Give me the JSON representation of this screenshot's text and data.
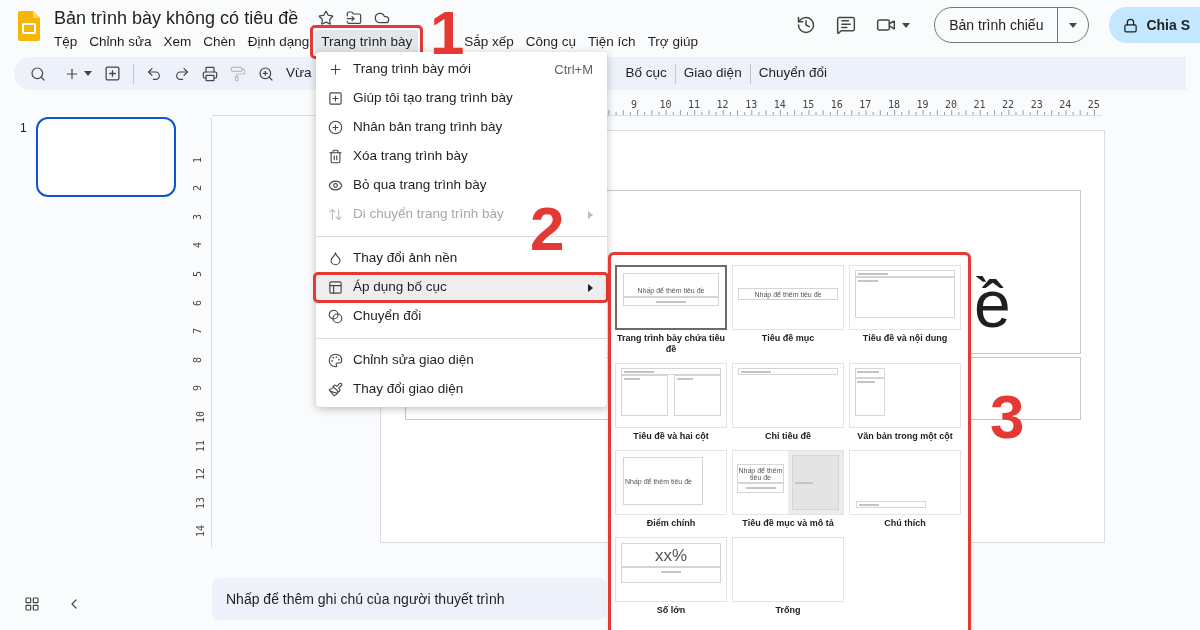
{
  "app": {
    "title": "Bản trình bày không có tiêu đề"
  },
  "menubar": [
    {
      "label": "Tệp",
      "selected": false,
      "annotated": false
    },
    {
      "label": "Chỉnh sửa",
      "selected": false,
      "annotated": false
    },
    {
      "label": "Xem",
      "selected": false,
      "annotated": false
    },
    {
      "label": "Chèn",
      "selected": false,
      "annotated": false
    },
    {
      "label": "Định dạng",
      "selected": false,
      "annotated": false
    },
    {
      "label": "Trang trình bày",
      "selected": true,
      "annotated": true
    },
    {
      "label": "Sắp xếp",
      "selected": false,
      "annotated": false
    },
    {
      "label": "Công cụ",
      "selected": false,
      "annotated": false
    },
    {
      "label": "Tiện ích",
      "selected": false,
      "annotated": false
    },
    {
      "label": "Trợ giúp",
      "selected": false,
      "annotated": false
    }
  ],
  "header_actions": {
    "present_button": "Bản trình chiếu",
    "share_button": "Chia S"
  },
  "toolbar": {
    "zoom_label": "Vừa",
    "paint_format": {
      "disabled": true
    },
    "buttons": [
      "Bố cục",
      "Giao diện",
      "Chuyển đổi"
    ]
  },
  "ruler": {
    "horizontal": [
      "9",
      "10",
      "11",
      "12",
      "13",
      "14",
      "15",
      "16",
      "17",
      "18",
      "19",
      "20",
      "21",
      "22",
      "23",
      "24",
      "25"
    ],
    "vertical": [
      "1",
      "2",
      "3",
      "4",
      "5",
      "6",
      "7",
      "8",
      "9",
      "10",
      "11",
      "12",
      "13",
      "14"
    ]
  },
  "filmstrip": {
    "slides": [
      {
        "number": "1",
        "selected": true
      }
    ]
  },
  "slide": {
    "title_visible": "ề"
  },
  "notes": {
    "placeholder": "Nhấp để thêm ghi chú của người thuyết trình"
  },
  "slide_menu": {
    "sections": [
      [
        {
          "label": "Trang trình bày mới",
          "shortcut": "Ctrl+M",
          "disabled": false,
          "submenu": false,
          "highlighted": false,
          "annotated": false
        },
        {
          "label": "Giúp tôi tạo trang trình bày",
          "disabled": false,
          "submenu": false,
          "highlighted": false,
          "annotated": false
        },
        {
          "label": "Nhân bản trang trình bày",
          "disabled": false,
          "submenu": false,
          "highlighted": false,
          "annotated": false
        },
        {
          "label": "Xóa trang trình bày",
          "disabled": false,
          "submenu": false,
          "highlighted": false,
          "annotated": false
        },
        {
          "label": "Bỏ qua trang trình bày",
          "disabled": false,
          "submenu": false,
          "highlighted": false,
          "annotated": false
        },
        {
          "label": "Di chuyển trang trình bày",
          "disabled": true,
          "submenu": true,
          "highlighted": false,
          "annotated": false
        }
      ],
      [
        {
          "label": "Thay đổi ảnh nền",
          "disabled": false,
          "submenu": false,
          "highlighted": false,
          "annotated": false
        },
        {
          "label": "Áp dụng bố cục",
          "disabled": false,
          "submenu": true,
          "highlighted": true,
          "annotated": true
        },
        {
          "label": "Chuyển đổi",
          "disabled": false,
          "submenu": false,
          "highlighted": false,
          "annotated": false
        }
      ],
      [
        {
          "label": "Chỉnh sửa giao diện",
          "disabled": false,
          "submenu": false,
          "highlighted": false,
          "annotated": false
        },
        {
          "label": "Thay đổi giao diện",
          "disabled": false,
          "submenu": false,
          "highlighted": false,
          "annotated": false
        }
      ]
    ]
  },
  "layout_submenu": {
    "annotated": true,
    "layouts": [
      {
        "kind": "title",
        "label": "Trang trình bày chứa tiêu đề",
        "selected": true,
        "title": "Nhấp để thêm tiêu đề"
      },
      {
        "kind": "section_header",
        "label": "Tiêu đề mục",
        "selected": false,
        "title": "Nhấp để thêm tiêu đề"
      },
      {
        "kind": "title_body",
        "label": "Tiêu đề và nội dung",
        "selected": false
      },
      {
        "kind": "two_columns",
        "label": "Tiêu đề và hai cột",
        "selected": false
      },
      {
        "kind": "title_only",
        "label": "Chỉ tiêu đề",
        "selected": false
      },
      {
        "kind": "one_column",
        "label": "Văn bản trong một cột",
        "selected": false
      },
      {
        "kind": "main_point",
        "label": "Điểm chính",
        "selected": false,
        "title": "Nhấp để thêm tiêu đề"
      },
      {
        "kind": "section_desc",
        "label": "Tiêu đề mục và mô tả",
        "selected": false,
        "title": "Nhấp để thêm tiêu đề"
      },
      {
        "kind": "caption",
        "label": "Chú thích",
        "selected": false
      },
      {
        "kind": "big_number",
        "label": "Số lớn",
        "selected": false,
        "title": "xx%"
      },
      {
        "kind": "blank",
        "label": "Trống",
        "selected": false
      }
    ]
  },
  "callouts": [
    "1",
    "2",
    "3"
  ]
}
